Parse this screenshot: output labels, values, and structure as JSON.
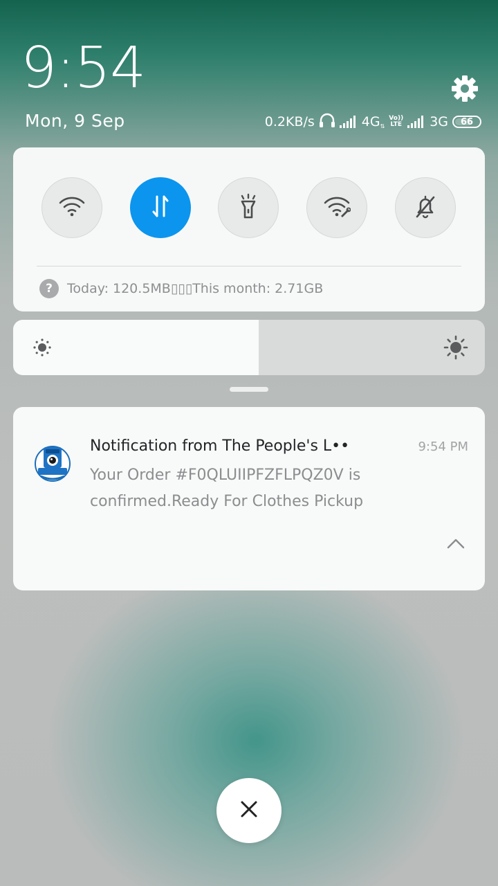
{
  "header": {
    "time": "9:54",
    "date": "Mon, 9 Sep",
    "settings_icon": "gear-icon"
  },
  "status_bar": {
    "network_speed": "0.2KB/s",
    "headphone_icon": "headphones-icon",
    "sim1_type": "4G",
    "volte_top": "Vo))",
    "volte_bottom": "LTE",
    "sim2_type": "3G",
    "battery": "66"
  },
  "quick_settings": {
    "toggles": [
      {
        "name": "wifi",
        "icon": "wifi-icon",
        "active": false
      },
      {
        "name": "mobile-data",
        "icon": "data-transfer-icon",
        "active": true
      },
      {
        "name": "flashlight",
        "icon": "flashlight-icon",
        "active": false
      },
      {
        "name": "hotspot",
        "icon": "wifi-hotspot-icon",
        "active": false
      },
      {
        "name": "silent",
        "icon": "bell-off-icon",
        "active": false
      }
    ],
    "help_glyph": "?",
    "usage_text": "Today: 120.5MB▯▯▯This month: 2.71GB",
    "active_color": "#0b95ee"
  },
  "brightness": {
    "level": 0.52
  },
  "notification": {
    "app_icon_label": "The People's",
    "title": "Notification from The People's L••",
    "time": "9:54 PM",
    "body": "Your Order #F0QLUIIPFZFLPQZ0V is confirmed.Ready For Clothes Pickup"
  },
  "controls": {
    "close_icon": "close-icon"
  }
}
